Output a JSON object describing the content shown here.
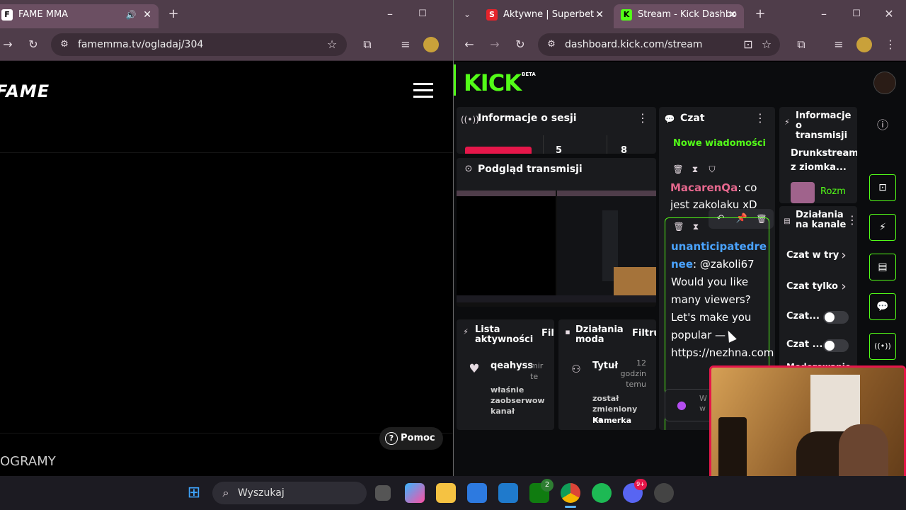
{
  "left_window": {
    "tab_title": "FAME MMA",
    "tab_favicon": "F",
    "url": "famemma.tv/ogladaj/304",
    "logo_text": "FAME",
    "help_button": "Pomoc",
    "bottom_text": "OGRAMY"
  },
  "right_window": {
    "tabs": [
      {
        "title": "Aktywne | Superbet",
        "favicon": "S"
      },
      {
        "title": "Stream - Kick Dashbo",
        "favicon": "K"
      }
    ],
    "url": "dashboard.kick.com/stream",
    "kick": {
      "logo": "KICK",
      "beta": "BETA",
      "session_info_title": "Informacje o sesji",
      "session_stat_1": "5",
      "session_stat_2": "8",
      "preview_title": "Podgląd transmisji",
      "chat_title": "Czat",
      "new_messages": "Nowe wiadomości",
      "messages": [
        {
          "user": "MacarenQa",
          "text": ": co jest zakolaku xD"
        },
        {
          "user": "unanticipatedrenee",
          "text": ": @zakoli67 Would you like many viewers? Let's make you popular — https://nezhna.com"
        }
      ],
      "chat_input_placeholder": "W\nw",
      "stream_info_title": "Informacje o transmisji",
      "stream_info_name": "Drunkstream z ziomka...",
      "stream_info_category": "Rozm",
      "channel_actions_title": "Działania na kanale",
      "channel_actions": [
        {
          "label": "Czat w try"
        },
        {
          "label": "Czat tylko"
        },
        {
          "label": "Czat..."
        },
        {
          "label": "Czat ..."
        }
      ],
      "moderowanie": "Moderowanie",
      "activity_title": "Lista aktywności",
      "activity_filter": "Filt",
      "activity_user": "qeahyss",
      "activity_time": "mir te",
      "activity_text": "właśnie zaobserwow kanał",
      "mod_title": "Działania moda",
      "mod_filter": "Filtruj",
      "mod_action_title": "Tytuł",
      "mod_action_time": "12 godzin temu",
      "mod_action_text": "został zmieniony na",
      "mod_action_value": "Kamerka"
    }
  },
  "taskbar": {
    "search_placeholder": "Wyszukaj",
    "xbox_badge": "2",
    "discord_badge": "9+"
  },
  "colors": {
    "kick_green": "#53fc18",
    "chrome_frame": "#4f3d4a",
    "chrome_active_tab": "#6b4f62",
    "username_pink": "#e6688e",
    "username_blue": "#4aa3ff"
  }
}
